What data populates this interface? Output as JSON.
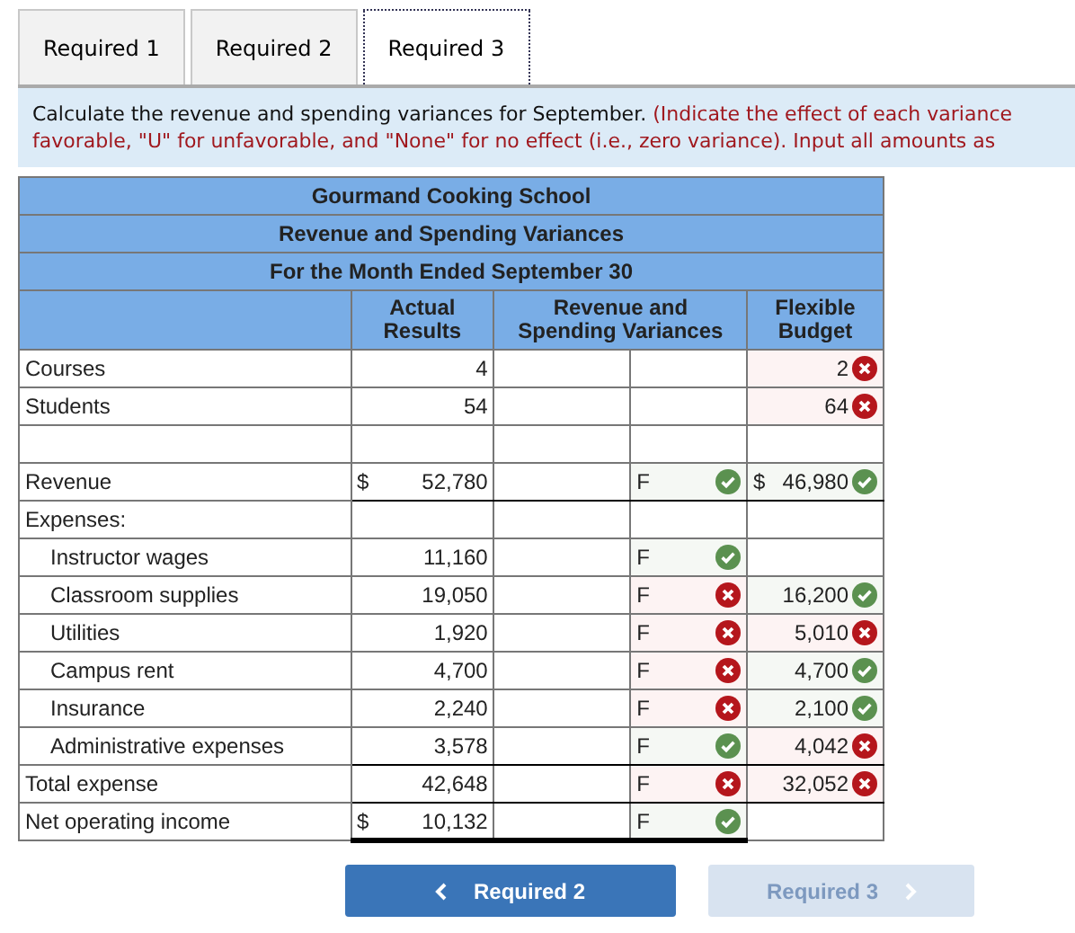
{
  "tabs": [
    {
      "label": "Required 1",
      "selected": false
    },
    {
      "label": "Required 2",
      "selected": false
    },
    {
      "label": "Required 3",
      "selected": true
    }
  ],
  "instructions": {
    "text": "Calculate the revenue and spending variances for September.",
    "note": "(Indicate the effect of each variance favorable, \"U\" for unfavorable, and \"None\" for no effect (i.e., zero variance). Input all amounts as"
  },
  "table": {
    "titles": [
      "Gourmand Cooking School",
      "Revenue and Spending Variances",
      "For the Month Ended September 30"
    ],
    "columns": [
      "Actual Results",
      "Revenue and Spending Variances",
      "Flexible Budget"
    ],
    "rows": [
      {
        "label": "Courses",
        "indent": false,
        "actual": "4",
        "budget": {
          "value": "2",
          "correct": false
        }
      },
      {
        "label": "Students",
        "indent": false,
        "actual": "54",
        "budget": {
          "value": "64",
          "correct": false
        }
      },
      {},
      {
        "label": "Revenue",
        "indent": false,
        "actual_dollar": "$",
        "actual": "52,780",
        "effect": {
          "value": "F",
          "correct": true
        },
        "budget": {
          "dollar": "$",
          "value": "46,980",
          "correct": true
        },
        "underlined": true
      },
      {
        "label": "Expenses:",
        "indent": false
      },
      {
        "label": "Instructor wages",
        "indent": true,
        "actual": "11,160",
        "effect": {
          "value": "F",
          "correct": true
        }
      },
      {
        "label": "Classroom supplies",
        "indent": true,
        "actual": "19,050",
        "effect": {
          "value": "F",
          "correct": false
        },
        "budget": {
          "value": "16,200",
          "correct": true
        }
      },
      {
        "label": "Utilities",
        "indent": true,
        "actual": "1,920",
        "effect": {
          "value": "F",
          "correct": false
        },
        "budget": {
          "value": "5,010",
          "correct": false
        }
      },
      {
        "label": "Campus rent",
        "indent": true,
        "actual": "4,700",
        "effect": {
          "value": "F",
          "correct": false
        },
        "budget": {
          "value": "4,700",
          "correct": true
        }
      },
      {
        "label": "Insurance",
        "indent": true,
        "actual": "2,240",
        "effect": {
          "value": "F",
          "correct": false
        },
        "budget": {
          "value": "2,100",
          "correct": true
        }
      },
      {
        "label": "Administrative expenses",
        "indent": true,
        "actual": "3,578",
        "effect": {
          "value": "F",
          "correct": true
        },
        "budget": {
          "value": "4,042",
          "correct": false
        },
        "underlined": true
      },
      {
        "label": "Total expense",
        "indent": false,
        "actual": "42,648",
        "effect": {
          "value": "F",
          "correct": false
        },
        "budget": {
          "value": "32,052",
          "correct": false
        },
        "underlined": true
      },
      {
        "label": "Net operating income",
        "indent": false,
        "actual_dollar": "$",
        "actual": "10,132",
        "effect": {
          "value": "F",
          "correct": true
        },
        "double_underlined": true
      }
    ]
  },
  "buttons": [
    {
      "label": "Required 2",
      "kind": "previous",
      "disabled": false
    },
    {
      "label": "Required 3",
      "kind": "next",
      "disabled": true
    }
  ]
}
